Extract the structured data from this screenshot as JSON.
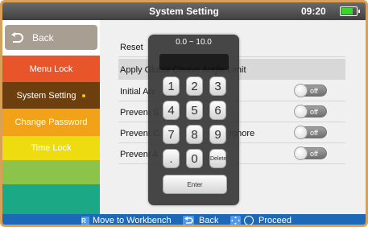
{
  "header": {
    "title": "System Setting",
    "time": "09:20",
    "battery_color": "#37d62c"
  },
  "sidebar": {
    "back_label": "Back",
    "items": [
      {
        "label": "Menu Lock",
        "color": "#e8552a"
      },
      {
        "label": "System Setting",
        "color": "#6e3f0e",
        "selected": true
      },
      {
        "label": "Change Password",
        "color": "#f2a218"
      },
      {
        "label": "Time Lock",
        "color": "#ecdc10"
      },
      {
        "label": "",
        "color": "#8cc34b"
      },
      {
        "label": "",
        "color": "#1aa984"
      }
    ]
  },
  "settings": {
    "rows": [
      {
        "label": "Reset"
      },
      {
        "label": "Apply Global Cleave Angle Limit"
      },
      {
        "label": "Initial Arc",
        "toggle": "off"
      },
      {
        "label": "Prevent S",
        "toggle": "off"
      },
      {
        "label": "Prevent C",
        "suffix": "Ignore",
        "toggle": "off"
      },
      {
        "label": "Prevent A",
        "toggle": "off"
      }
    ]
  },
  "keypad": {
    "range": "0.0 ~ 10.0",
    "keys": [
      "1",
      "2",
      "3",
      "4",
      "5",
      "6",
      "7",
      "8",
      "9",
      ".",
      "0",
      "Delete"
    ],
    "enter_label": "Enter"
  },
  "footer": {
    "r_key": "R",
    "workbench_label": "Move to Workbench",
    "back_label": "Back",
    "proceed_label": "Proceed"
  }
}
